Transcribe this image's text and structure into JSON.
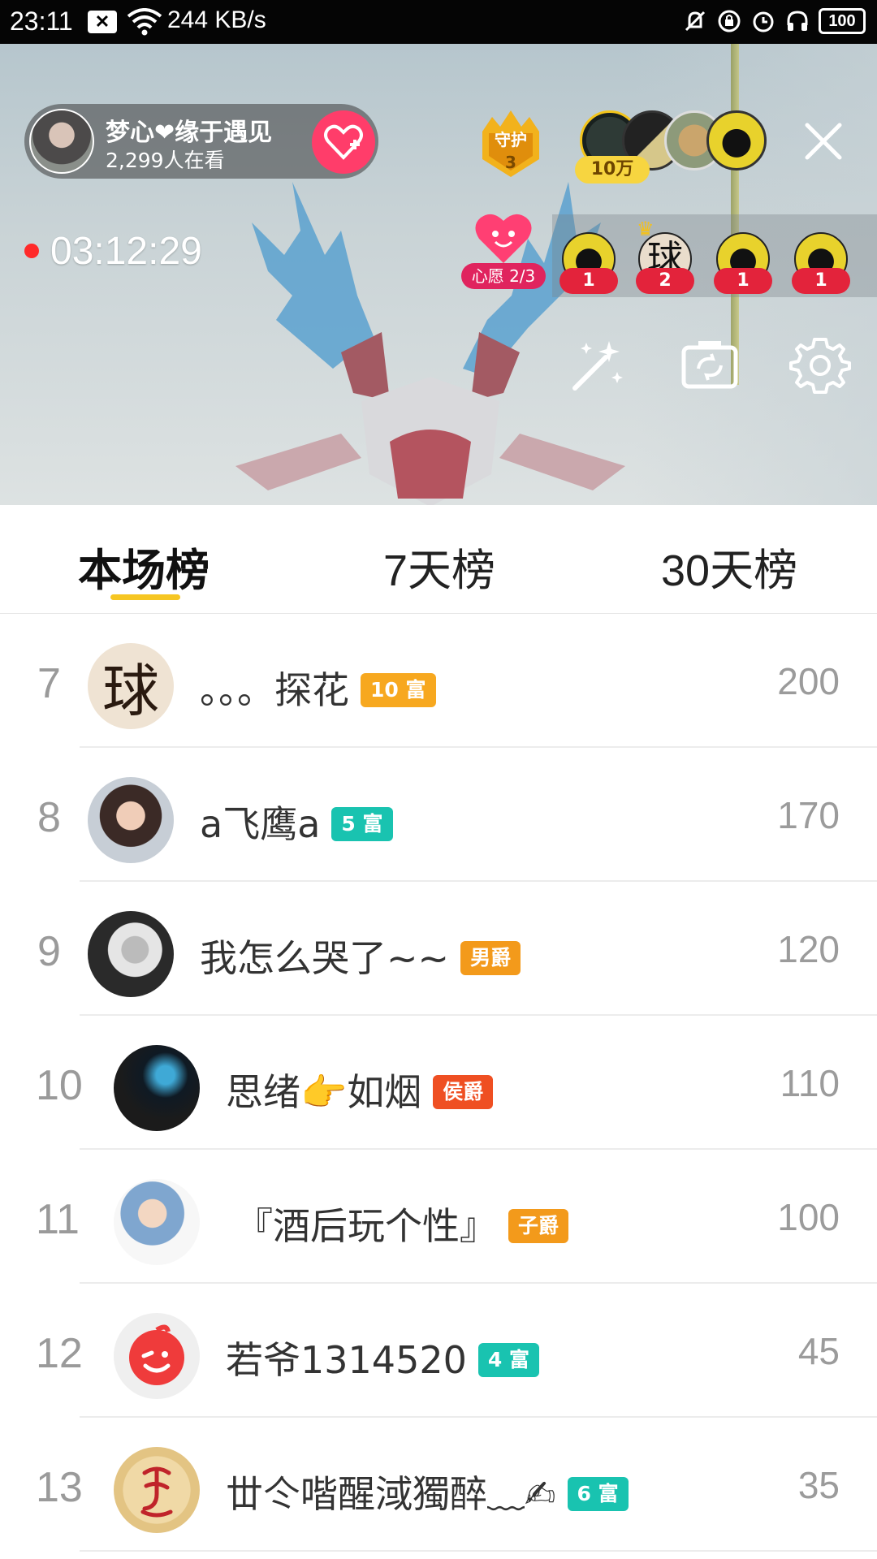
{
  "status_bar": {
    "time": "23:11",
    "speed": "244 KB/s",
    "battery": "100"
  },
  "live": {
    "host_name": "梦心❤缘于遇见",
    "viewers": "2,299人在看",
    "guard_label": "守护",
    "guard_count": "3",
    "top_tag": "10万",
    "timer": "03:12:29",
    "wish_label": "心愿 2/3",
    "fans": [
      {
        "count": "1"
      },
      {
        "count": "2"
      },
      {
        "count": "1"
      },
      {
        "count": "1"
      }
    ],
    "fan_avatar_text": "球"
  },
  "tabs": [
    "本场榜",
    "7天榜",
    "30天榜"
  ],
  "colors": {
    "accent": "#f6c622",
    "badge_orange": "#f6a623",
    "badge_teal": "#19c3b0",
    "badge_red": "#f25a2c",
    "follow_pink": "#ff3d6a"
  },
  "ranking": [
    {
      "rank": "7",
      "name": "。。。探花",
      "badge": "10 富",
      "badge_color": "#f7a81f",
      "score": "200",
      "avatar": "char-qiu"
    },
    {
      "rank": "8",
      "name": "a飞鹰a",
      "badge": "5 富",
      "badge_color": "#19c3b0",
      "score": "170",
      "avatar": "woman-photo"
    },
    {
      "rank": "9",
      "name": "我怎么哭了~~",
      "badge": "男爵",
      "badge_color": "#f39a1b",
      "score": "120",
      "avatar": "old-man-photo"
    },
    {
      "rank": "10",
      "name": "思绪👉如烟",
      "badge": "侯爵",
      "badge_color": "#ef4f22",
      "score": "110",
      "avatar": "smoke-photo"
    },
    {
      "rank": "11",
      "name": "『酒后玩个性』",
      "badge": "子爵",
      "badge_color": "#f39a1b",
      "score": "100",
      "avatar": "baby-cartoon"
    },
    {
      "rank": "12",
      "name": "若爷1314520",
      "badge": "4 富",
      "badge_color": "#19c3b0",
      "score": "45",
      "avatar": "red-smile"
    },
    {
      "rank": "13",
      "name": "丗仒喈醒淢獨醉﹏✍",
      "badge": "6 富",
      "badge_color": "#19c3b0",
      "score": "35",
      "avatar": "seal-logo"
    }
  ]
}
